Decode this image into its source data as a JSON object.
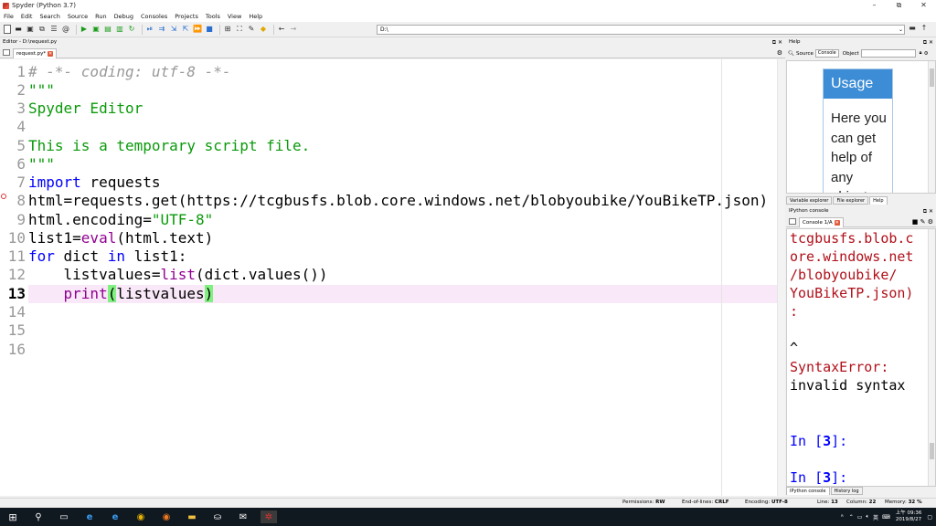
{
  "window": {
    "title": "Spyder (Python 3.7)",
    "minimize": "–",
    "maximize": "⧉",
    "close": "✕"
  },
  "menu": [
    "File",
    "Edit",
    "Search",
    "Source",
    "Run",
    "Debug",
    "Consoles",
    "Projects",
    "Tools",
    "View",
    "Help"
  ],
  "toolbar": {
    "path": "D:\\"
  },
  "editor": {
    "pane_title": "Editor - D:\\request.py",
    "tab_label": "request.py*",
    "current_line": 13,
    "breakpoint_line": 8,
    "line_numbers": [
      "1",
      "2",
      "3",
      "4",
      "5",
      "6",
      "7",
      "8",
      "9",
      "10",
      "11",
      "12",
      "13",
      "14",
      "15",
      "16"
    ],
    "lines": {
      "l1": "# -*- coding: utf-8 -*-",
      "l2": "\"\"\"",
      "l3": "Spyder Editor",
      "l4": "",
      "l5": "This is a temporary script file.",
      "l6": "\"\"\"",
      "l7_kw": "import",
      "l7_rest": " requests",
      "l8": "html=requests.get(https://tcgbusfs.blob.core.windows.net/blobyoubike/YouBikeTP.json)",
      "l9_a": "html.encoding=",
      "l9_str": "\"UTF-8\"",
      "l10_a": "list1=",
      "l10_bi": "eval",
      "l10_b": "(html.text)",
      "l11_kw1": "for",
      "l11_a": " dict ",
      "l11_kw2": "in",
      "l11_b": " list1:",
      "l12_a": "    listvalues=",
      "l12_bi": "list",
      "l12_b": "(dict.values())",
      "l13_indent": "    ",
      "l13_bi": "print",
      "l13_p1": "(",
      "l13_mid": "listvalues",
      "l13_p2": ")"
    }
  },
  "help": {
    "pane_title": "Help",
    "source_label": "Source",
    "source_value": "Console",
    "object_label": "Object",
    "usage_title": "Usage",
    "usage_text": "Here you can get help of any object"
  },
  "right_tabs": {
    "variable_explorer": "Variable explorer",
    "file_explorer": "File explorer",
    "help": "Help"
  },
  "console": {
    "pane_title": "IPython console",
    "tab_label": "Console 1/A",
    "lines": {
      "c1": "tcgbusfs.blob.c",
      "c2": "ore.windows.net",
      "c3": "/blobyoubike/",
      "c4": "YouBikeTP.json)",
      "c5": ":",
      "c6": "^",
      "c7": "SyntaxError:",
      "c8": "invalid syntax",
      "p1": "In [",
      "p1n": "3",
      "p1e": "]:",
      "p2": "In [",
      "p2n": "3",
      "p2e": "]:"
    }
  },
  "console_tabs": {
    "ipython": "IPython console",
    "history": "History log"
  },
  "status": {
    "permissions_label": "Permissions:",
    "permissions": "RW",
    "eol_label": "End-of-lines:",
    "eol": "CRLF",
    "encoding_label": "Encoding:",
    "encoding": "UTF-8",
    "line_label": "Line:",
    "line": "13",
    "column_label": "Column:",
    "column": "22",
    "memory_label": "Memory:",
    "memory": "32 %"
  },
  "taskbar": {
    "ime": "英",
    "time": "上午 09:36",
    "date": "2019/8/27"
  },
  "colors": {
    "keyword": "#0000ff",
    "string": "#0a9a0a",
    "builtin": "#900090",
    "error": "#b0101a",
    "usage_header": "#3c8dd6"
  }
}
